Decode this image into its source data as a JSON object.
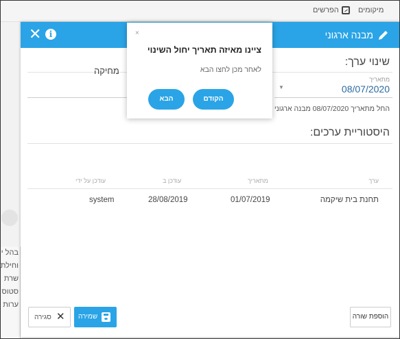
{
  "topbar": {
    "tabs": [
      {
        "label": "מיקומים"
      },
      {
        "label": "הפרשים"
      }
    ]
  },
  "side": {
    "lines": [
      "בהל י",
      "וחילת",
      "שרת",
      "סטוס",
      "ערות"
    ]
  },
  "modal": {
    "title": "מבנה ארגוני",
    "close_glyph": "✕",
    "info_glyph": "i",
    "change_heading": "שינוי ערך:",
    "from_date_label": "מתאריך",
    "from_date_value": "08/07/2020",
    "structure_value": "מחיקה",
    "note": "החל מתאריך 08/07/2020 מבנה ארגוני יהיה ו",
    "history_heading": "היסטוריית ערכים:",
    "table": {
      "headers": [
        "ערך",
        "מתאריך",
        "עודכן ב",
        "עודכן על ידי"
      ],
      "rows": [
        [
          "תחנת בית שיקמה",
          "01/07/2019",
          "28/08/2019",
          "system"
        ]
      ]
    },
    "buttons": {
      "add_row": "הוספת שורה",
      "save": "שמירה",
      "close": "סגירה",
      "close_glyph": "✕"
    }
  },
  "popover": {
    "close_glyph": "×",
    "title": "ציינו מאיזה תאריך יחול השינוי",
    "body": "לאחר מכן לחצו הבא",
    "prev_label": "הקודם",
    "next_label": "הבא"
  },
  "colors": {
    "accent": "#2aa4e6"
  }
}
